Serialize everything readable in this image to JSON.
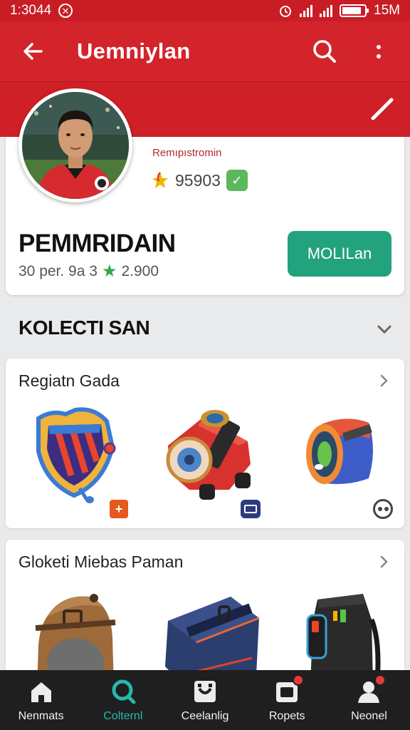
{
  "status_bar": {
    "time": "1:3044",
    "battery_label": "15M",
    "battery_level": 0.85
  },
  "app_bar": {
    "title": "Uemniylan"
  },
  "profile": {
    "subtitle": "Remıpıstromin",
    "points": "95903",
    "name": "PEMMRIDAIN",
    "stats_left": "30 per. 9a 3",
    "stats_right": "2.900",
    "follow_label": "MOLILan"
  },
  "section": {
    "title": "KOLECTI SAN"
  },
  "collections": [
    {
      "title": "Regiatn Gada"
    },
    {
      "title": "Gloketi Miebas Paman"
    }
  ],
  "bottom_nav": [
    {
      "label": "Nenmats",
      "icon": "home-icon",
      "active": false
    },
    {
      "label": "Colternl",
      "icon": "search-circle-icon",
      "active": true
    },
    {
      "label": "Ceelanlig",
      "icon": "gallery-icon",
      "active": false
    },
    {
      "label": "Ropets",
      "icon": "report-icon",
      "active": false
    },
    {
      "label": "Neonel",
      "icon": "profile-icon",
      "active": false
    }
  ],
  "colors": {
    "primary": "#d3242b",
    "accent": "#22a27d",
    "active_nav": "#25b9ad"
  }
}
